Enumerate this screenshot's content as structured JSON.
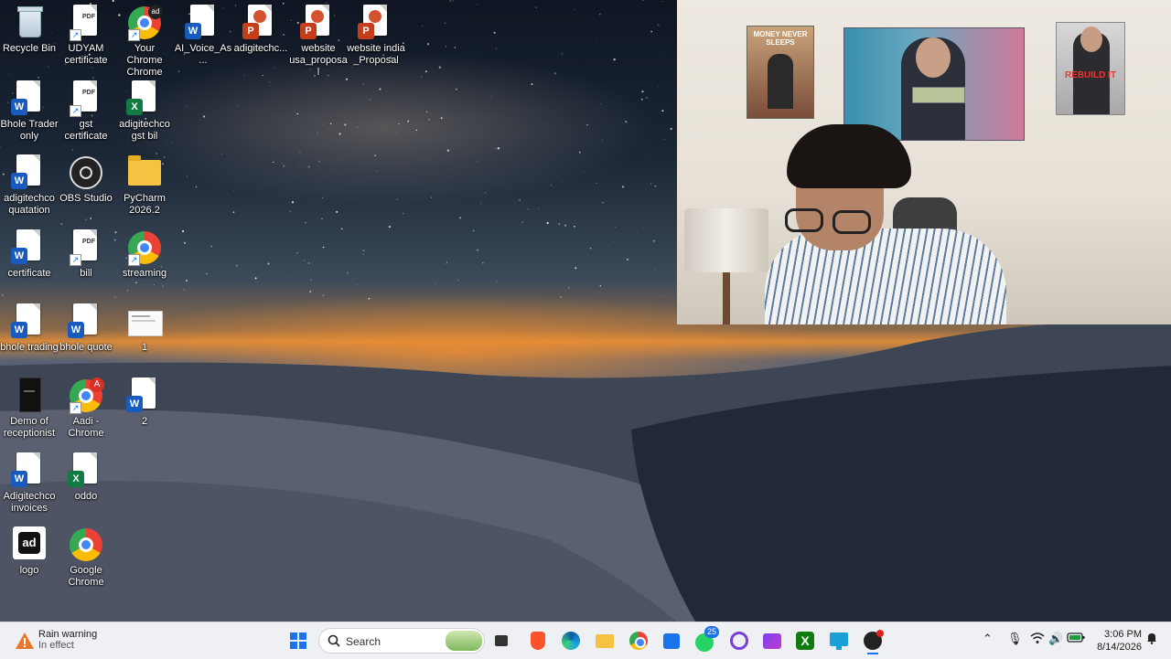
{
  "desktop": {
    "icons": [
      {
        "label": "Recycle Bin",
        "icon": "recycle-bin-icon"
      },
      {
        "label": "UDYAM certificate",
        "icon": "pdf-icon"
      },
      {
        "label": "Your Chrome Chrome",
        "icon": "chrome-icon"
      },
      {
        "label": "AI_Voice_As...",
        "icon": "word-icon"
      },
      {
        "label": "adigitechc...",
        "icon": "powerpoint-icon"
      },
      {
        "label": "website usa_proposal",
        "icon": "powerpoint-icon"
      },
      {
        "label": "website india _Proposal",
        "icon": "powerpoint-icon"
      },
      {
        "label": "Bhole Trader only",
        "icon": "word-icon"
      },
      {
        "label": "gst certificate",
        "icon": "pdf-icon"
      },
      {
        "label": "adigitechco gst bil",
        "icon": "excel-icon"
      },
      {
        "label": "adigitechco quatation",
        "icon": "word-icon"
      },
      {
        "label": "OBS Studio",
        "icon": "obs-icon"
      },
      {
        "label": "PyCharm 2026.2",
        "icon": "folder-icon"
      },
      {
        "label": "certificate",
        "icon": "word-icon"
      },
      {
        "label": "bill",
        "icon": "pdf-icon"
      },
      {
        "label": "streaming",
        "icon": "chrome-icon"
      },
      {
        "label": "bhole trading",
        "icon": "word-icon"
      },
      {
        "label": "bhole quote",
        "icon": "word-icon"
      },
      {
        "label": "1",
        "icon": "image-icon"
      },
      {
        "label": "Demo of receptionist",
        "icon": "video-icon"
      },
      {
        "label": "Aadi - Chrome",
        "icon": "chrome-icon"
      },
      {
        "label": "2",
        "icon": "word-icon"
      },
      {
        "label": "Adigitechco invoices",
        "icon": "word-icon"
      },
      {
        "label": "oddo",
        "icon": "excel-icon"
      },
      {
        "label": "logo",
        "icon": "logo-icon"
      },
      {
        "label": "Google Chrome",
        "icon": "chrome-icon"
      }
    ],
    "chrome_badge_aadi": "A",
    "chrome_badge_your": "ad"
  },
  "webcam": {
    "poster_left_text": "MONEY NEVER SLEEPS",
    "poster_right_text": "REBUILD IT"
  },
  "taskbar": {
    "weather_title": "Rain warning",
    "weather_sub": "In effect",
    "search_label": "Search",
    "whatsapp_badge": "25",
    "clock_time": "3:06 PM",
    "clock_date": "8/14/2026",
    "apps": [
      "start-icon",
      "search-icon",
      "widgets-icon",
      "task-view-icon",
      "brave-icon",
      "edge-icon",
      "file-explorer-icon",
      "chrome-icon",
      "store-icon",
      "whatsapp-icon",
      "app-icon",
      "clipchamp-icon",
      "xbox-icon",
      "remote-desktop-icon",
      "obs-icon"
    ]
  }
}
